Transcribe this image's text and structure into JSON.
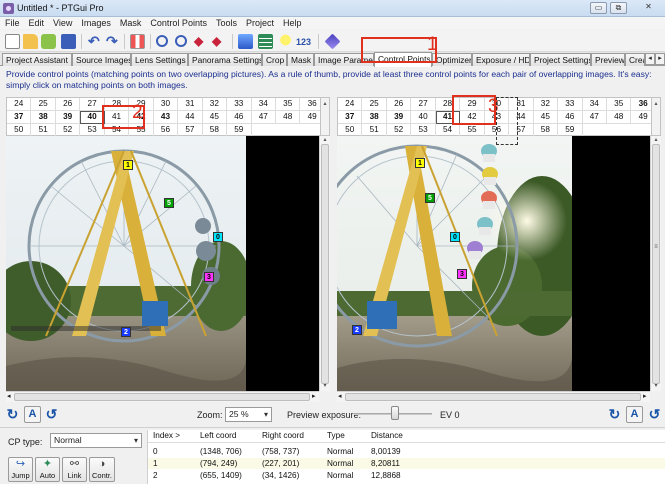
{
  "window": {
    "title": "Untitled * - PTGui Pro",
    "min_glyph": "▭",
    "max_glyph": "⧉",
    "close_glyph": "✕"
  },
  "menu": [
    "File",
    "Edit",
    "View",
    "Images",
    "Mask",
    "Control Points",
    "Tools",
    "Project",
    "Help"
  ],
  "toolbar": {
    "icons": [
      "new-project-icon",
      "open-folder-icon",
      "open-images-icon",
      "save-icon",
      "undo-icon",
      "redo-icon",
      "lens-icon",
      "zoom-in-icon",
      "zoom-out-icon",
      "prev-arrow-icon",
      "next-arrow-icon",
      "panorama-editor-icon",
      "table-icon",
      "tip-bulb-icon",
      "numbering-icon",
      "help-book-icon"
    ],
    "numbering_text": "123"
  },
  "tabs": [
    "Project Assistant",
    "Source Images",
    "Lens Settings",
    "Panorama Settings",
    "Crop",
    "Mask",
    "Image Parameters",
    "Control Points",
    "Optimizer",
    "Exposure / HDR",
    "Project Settings",
    "Preview",
    "Crea"
  ],
  "active_tab": "Control Points",
  "tab_scroll": {
    "left": "◂",
    "right": "▸"
  },
  "instructions": "Provide control points (matching points on two overlapping pictures). As a rule of thumb, provide at least three control points for each pair of overlapping images. It's easy: simply click on matching points on both images.",
  "left_grid": {
    "rows": [
      [
        "24",
        "25",
        "26",
        "27",
        "28",
        "29",
        "30",
        "31",
        "32",
        "33",
        "34",
        "35"
      ],
      [
        "36",
        "37",
        "38",
        "39",
        "40",
        "41",
        "42",
        "43",
        "44",
        "45",
        "46",
        "47"
      ],
      [
        "48",
        "49",
        "50",
        "51",
        "52",
        "53",
        "54",
        "55",
        "56",
        "57",
        "58",
        "59"
      ]
    ],
    "selected": "40",
    "bold": [
      "37",
      "38",
      "39",
      "40",
      "42",
      "43"
    ]
  },
  "right_grid": {
    "rows": [
      [
        "24",
        "25",
        "26",
        "27",
        "28",
        "29",
        "30",
        "31",
        "32",
        "33",
        "34",
        "35"
      ],
      [
        "36",
        "37",
        "38",
        "39",
        "40",
        "41",
        "42",
        "43",
        "44",
        "45",
        "46",
        "47"
      ],
      [
        "48",
        "49",
        "50",
        "51",
        "52",
        "53",
        "54",
        "55",
        "56",
        "57",
        "58",
        "59"
      ]
    ],
    "selected": "41",
    "bold": [
      "36",
      "37",
      "38",
      "39"
    ]
  },
  "markers": {
    "left": [
      {
        "id": "1",
        "color": "#ffff00"
      },
      {
        "id": "5",
        "color": "#00a000"
      },
      {
        "id": "0",
        "color": "#00e5ff"
      },
      {
        "id": "3",
        "color": "#ff33ff"
      },
      {
        "id": "2",
        "color": "#1a3cff"
      }
    ],
    "right": [
      {
        "id": "1",
        "color": "#ffff00"
      },
      {
        "id": "5",
        "color": "#00a000"
      },
      {
        "id": "0",
        "color": "#00e5ff"
      },
      {
        "id": "3",
        "color": "#ff33ff"
      },
      {
        "id": "2",
        "color": "#1a3cff"
      }
    ]
  },
  "annotations": [
    "1",
    "2",
    "3"
  ],
  "controls": {
    "zoom_label": "Zoom:",
    "zoom_value": "25 %",
    "preview_label": "Preview exposure:",
    "ev_label": "EV 0",
    "rotate_left": "↻",
    "auto_label": "A",
    "rotate_right": "↺"
  },
  "cp_type": {
    "label": "CP type:",
    "value": "Normal"
  },
  "actions": [
    {
      "label": "Jump",
      "icon": "jump-icon",
      "glyph": "↪"
    },
    {
      "label": "Auto",
      "icon": "auto-icon",
      "glyph": "✦"
    },
    {
      "label": "Link",
      "icon": "link-icon",
      "glyph": "⚯"
    },
    {
      "label": "Contr.",
      "icon": "control-icon",
      "glyph": "◑"
    }
  ],
  "table": {
    "headers": [
      "Index >",
      "Left coord",
      "Right coord",
      "Type",
      "Distance"
    ],
    "rows": [
      [
        "0",
        "(1348, 706)",
        "(758, 737)",
        "Normal",
        "8,00139"
      ],
      [
        "1",
        "(794, 249)",
        "(227, 201)",
        "Normal",
        "8,20811"
      ],
      [
        "2",
        "(655, 1409)",
        "(34, 1426)",
        "Normal",
        "12,8868"
      ]
    ]
  },
  "scroll_glyphs": {
    "up": "▴",
    "down": "▾",
    "left": "◂",
    "right": "▸",
    "grip": "≡"
  }
}
